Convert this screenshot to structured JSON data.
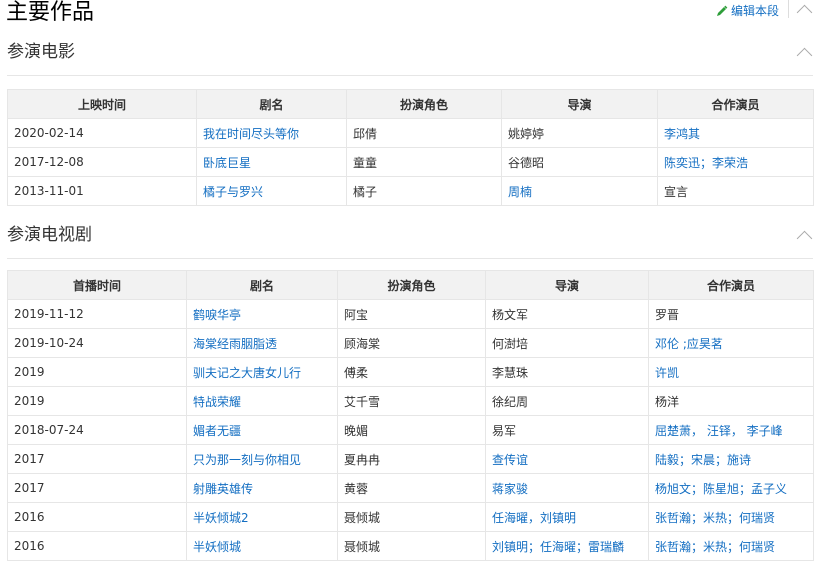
{
  "page_title": "主要作品",
  "edit_label": "编辑本段",
  "movies": {
    "heading": "参演电影",
    "headers": [
      "上映时间",
      "剧名",
      "扮演角色",
      "导演",
      "合作演员"
    ],
    "rows": [
      [
        {
          "t": "2020-02-14"
        },
        {
          "t": "我在时间尽头等你",
          "link": true
        },
        {
          "t": "邱倩"
        },
        {
          "t": "姚婷婷"
        },
        {
          "t": "李鸿其",
          "link": true
        }
      ],
      [
        {
          "t": "2017-12-08"
        },
        {
          "t": "卧底巨星",
          "link": true
        },
        {
          "t": "童童"
        },
        {
          "t": "谷德昭"
        },
        {
          "t": "陈奕迅；李荣浩",
          "link": true
        }
      ],
      [
        {
          "t": "2013-11-01"
        },
        {
          "t": "橘子与罗兴",
          "link": true
        },
        {
          "t": "橘子"
        },
        {
          "t": "周楠",
          "link": true
        },
        {
          "t": "宣言"
        }
      ]
    ]
  },
  "tv": {
    "heading": "参演电视剧",
    "headers": [
      "首播时间",
      "剧名",
      "扮演角色",
      "导演",
      "合作演员"
    ],
    "rows": [
      [
        {
          "t": "2019-11-12"
        },
        {
          "t": "鹤唳华亭",
          "link": true
        },
        {
          "t": "阿宝"
        },
        {
          "t": "杨文军"
        },
        {
          "t": "罗晋"
        }
      ],
      [
        {
          "t": "2019-10-24"
        },
        {
          "t": "海棠经雨胭脂透",
          "link": true
        },
        {
          "t": "顾海棠"
        },
        {
          "t": "何澍培"
        },
        {
          "t": "邓伦 ;应昊茗",
          "link": true
        }
      ],
      [
        {
          "t": "2019"
        },
        {
          "t": "驯夫记之大唐女儿行",
          "link": true
        },
        {
          "t": "傅柔"
        },
        {
          "t": "李慧珠"
        },
        {
          "t": "许凯",
          "link": true
        }
      ],
      [
        {
          "t": "2019"
        },
        {
          "t": "特战荣耀",
          "link": true
        },
        {
          "t": "艾千雪"
        },
        {
          "t": "徐纪周"
        },
        {
          "t": "杨洋"
        }
      ],
      [
        {
          "t": "2018-07-24"
        },
        {
          "t": "媚者无疆",
          "link": true
        },
        {
          "t": "晚媚"
        },
        {
          "t": "易军"
        },
        {
          "t": "屈楚萧， 汪铎， 李子峰",
          "link": true
        }
      ],
      [
        {
          "t": "2017"
        },
        {
          "t": "只为那一刻与你相见",
          "link": true
        },
        {
          "t": "夏冉冉"
        },
        {
          "t": "查传谊",
          "link": true
        },
        {
          "t": "陆毅；宋晨；施诗",
          "link": true
        }
      ],
      [
        {
          "t": "2017"
        },
        {
          "t": "射雕英雄传",
          "link": true
        },
        {
          "t": "黄蓉"
        },
        {
          "t": "蒋家骏",
          "link": true
        },
        {
          "t": "杨旭文；陈星旭；孟子义",
          "link": true
        }
      ],
      [
        {
          "t": "2016"
        },
        {
          "t": "半妖倾城2",
          "link": true
        },
        {
          "t": "聂倾城"
        },
        {
          "t": "任海曜，刘镇明",
          "link": true
        },
        {
          "t": "张哲瀚；米热；何瑞贤",
          "link": true
        }
      ],
      [
        {
          "t": "2016"
        },
        {
          "t": "半妖倾城",
          "link": true
        },
        {
          "t": "聂倾城"
        },
        {
          "t": "刘镇明；任海曜；雷瑞麟",
          "link": true
        },
        {
          "t": "张哲瀚；米热；何瑞贤",
          "link": true
        }
      ]
    ]
  }
}
